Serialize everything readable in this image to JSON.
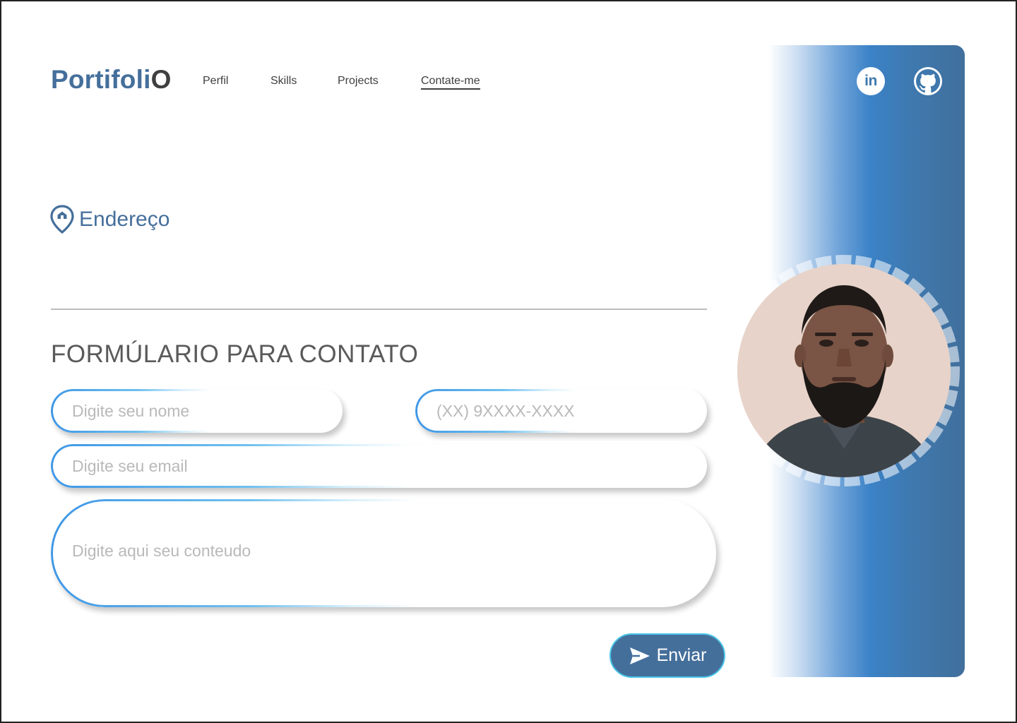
{
  "header": {
    "logo_main": "Portifoli",
    "logo_end": "O",
    "nav": [
      {
        "label": "Perfil"
      },
      {
        "label": "Skills"
      },
      {
        "label": "Projects"
      },
      {
        "label": "Contate-me",
        "active": true
      }
    ],
    "social": [
      {
        "icon": "linkedin-icon",
        "text": "in"
      },
      {
        "icon": "github-icon"
      }
    ]
  },
  "address": {
    "icon": "location-pin-icon",
    "label": "Endereço"
  },
  "form": {
    "title": "FORMÚLARIO PARA CONTATO",
    "name_placeholder": "Digite seu nome",
    "phone_placeholder": "(XX) 9XXXX-XXXX",
    "email_placeholder": "Digite seu email",
    "message_placeholder": "Digite aqui seu conteudo",
    "submit_label": "Enviar",
    "submit_icon": "send-icon"
  },
  "profile": {
    "avatar": "profile-photo"
  },
  "colors": {
    "brand": "#456f9b",
    "accent_blue": "#3b82c7",
    "input_border": "#3e97e6",
    "text_dark": "#3f3f3f"
  }
}
